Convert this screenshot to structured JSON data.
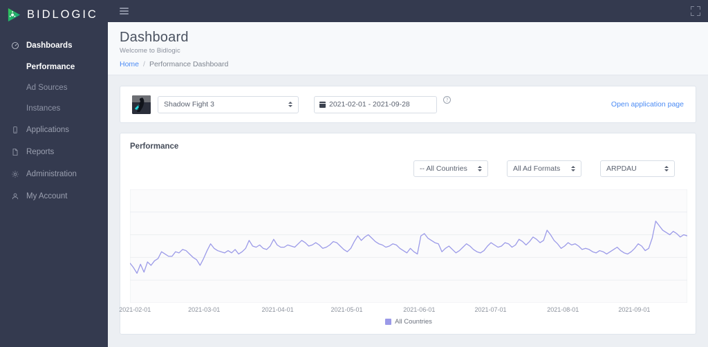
{
  "brand": {
    "name": "BIDLOGIC",
    "logo_icon": "play-triangle-logo"
  },
  "sidebar": {
    "items": [
      {
        "label": "Dashboards",
        "icon": "gauge-icon",
        "active": true,
        "level": "top"
      },
      {
        "label": "Performance",
        "icon": "",
        "active": true,
        "level": "sub"
      },
      {
        "label": "Ad Sources",
        "icon": "",
        "active": false,
        "level": "sub"
      },
      {
        "label": "Instances",
        "icon": "",
        "active": false,
        "level": "sub"
      },
      {
        "label": "Applications",
        "icon": "phone-icon",
        "active": false,
        "level": "top"
      },
      {
        "label": "Reports",
        "icon": "document-icon",
        "active": false,
        "level": "top"
      },
      {
        "label": "Administration",
        "icon": "gear-icon",
        "active": false,
        "level": "top"
      },
      {
        "label": "My Account",
        "icon": "user-icon",
        "active": false,
        "level": "top"
      }
    ]
  },
  "topbar": {
    "menu_icon": "hamburger-icon",
    "expand_icon": "fullscreen-icon"
  },
  "page": {
    "title": "Dashboard",
    "subtitle": "Welcome to Bidlogic",
    "breadcrumb_home": "Home",
    "breadcrumb_sep": "/",
    "breadcrumb_current": "Performance Dashboard"
  },
  "filter_bar": {
    "app_thumb_icon": "shadow-fight-app-icon",
    "app_select_value": "Shadow Fight 3",
    "date_range_value": "2021-02-01 - 2021-09-28",
    "calendar_icon": "calendar-icon",
    "help_icon": "help-circle-icon",
    "help_glyph": "?",
    "open_app_link": "Open application page"
  },
  "performance": {
    "title": "Performance",
    "country_select": "-- All Countries",
    "format_select": "All Ad Formats",
    "metric_select": "ARPDAU"
  },
  "chart_data": {
    "type": "line",
    "title": "Performance",
    "xlabel": "",
    "ylabel": "",
    "legend": [
      "All Countries"
    ],
    "legend_position": "bottom",
    "grid": true,
    "series_color": "#9b9ae8",
    "xlim": [
      "2021-02-01",
      "2021-09-28"
    ],
    "ylim": [
      0,
      100
    ],
    "gridline_values": [
      0,
      20,
      40,
      60,
      80,
      100
    ],
    "tick_labels": [
      "2021-02-01",
      "2021-03-01",
      "2021-04-01",
      "2021-05-01",
      "2021-06-01",
      "2021-07-01",
      "2021-08-01",
      "2021-09-01"
    ],
    "tick_positions_pct": [
      0.9,
      13.3,
      26.5,
      38.9,
      51.9,
      64.7,
      77.7,
      90.5
    ],
    "series": [
      {
        "name": "All Countries",
        "values": [
          35,
          31,
          26,
          34,
          27,
          36,
          33,
          37,
          39,
          45,
          43,
          41,
          41,
          45,
          44,
          47,
          46,
          43,
          40,
          38,
          33,
          39,
          46,
          52,
          48,
          46,
          45,
          44,
          46,
          44,
          47,
          43,
          45,
          48,
          55,
          50,
          49,
          51,
          48,
          47,
          50,
          56,
          51,
          49,
          49,
          51,
          50,
          49,
          52,
          55,
          53,
          50,
          51,
          53,
          51,
          48,
          49,
          51,
          54,
          53,
          50,
          47,
          45,
          48,
          54,
          59,
          55,
          58,
          60,
          57,
          54,
          52,
          51,
          49,
          50,
          52,
          51,
          48,
          46,
          44,
          48,
          45,
          43,
          59,
          61,
          57,
          55,
          53,
          52,
          45,
          48,
          50,
          47,
          44,
          46,
          49,
          52,
          50,
          47,
          45,
          44,
          46,
          50,
          53,
          51,
          49,
          50,
          53,
          52,
          49,
          51,
          56,
          54,
          51,
          54,
          58,
          56,
          53,
          55,
          64,
          60,
          55,
          52,
          48,
          50,
          53,
          51,
          52,
          50,
          47,
          48,
          47,
          45,
          44,
          46,
          45,
          43,
          45,
          47,
          49,
          46,
          44,
          43,
          45,
          48,
          52,
          50,
          46,
          48,
          57,
          72,
          68,
          64,
          62,
          60,
          63,
          61,
          58,
          60,
          59
        ]
      }
    ]
  }
}
